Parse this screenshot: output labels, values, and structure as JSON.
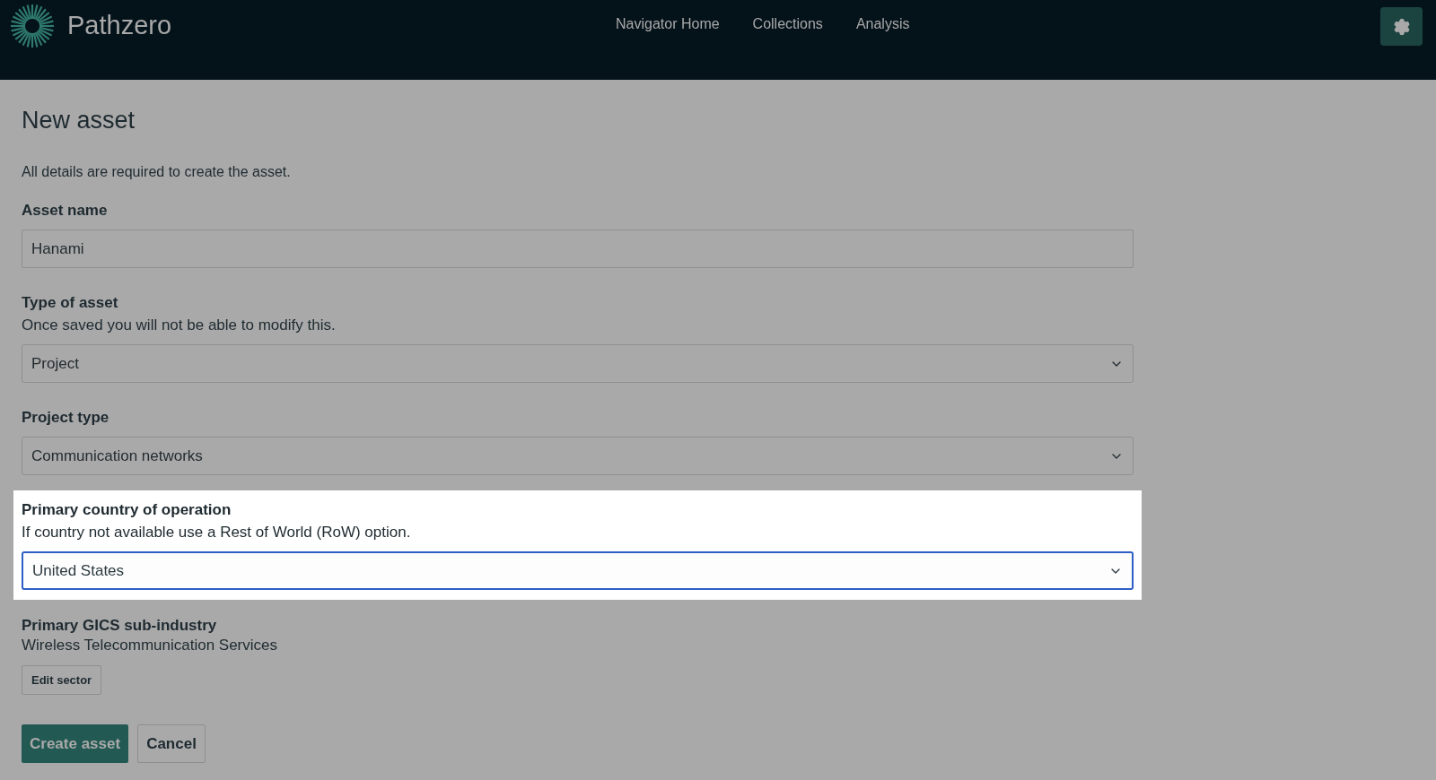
{
  "header": {
    "brand": "Pathzero",
    "nav": [
      {
        "label": "Navigator Home"
      },
      {
        "label": "Collections"
      },
      {
        "label": "Analysis"
      }
    ]
  },
  "page": {
    "title": "New asset",
    "intro": "All details are required to create the asset."
  },
  "fields": [
    {
      "kind": "text",
      "label": "Asset name",
      "value": "Hanami",
      "highlighted": false
    },
    {
      "kind": "select",
      "label": "Type of asset",
      "hint": "Once saved you will not be able to modify this.",
      "value": "Project",
      "highlighted": false
    },
    {
      "kind": "select",
      "label": "Project type",
      "value": "Communication networks",
      "highlighted": false
    },
    {
      "kind": "select",
      "label": "Primary country of operation",
      "hint": "If country not available use a Rest of World (RoW) option.",
      "value": "United States",
      "highlighted": true
    }
  ],
  "sub_industry": {
    "label": "Primary GICS sub-industry",
    "value": "Wireless Telecommunication Services",
    "button": "Edit sector"
  },
  "actions": [
    {
      "label": "Create asset",
      "kind": "primary"
    },
    {
      "label": "Cancel",
      "kind": "secondary"
    }
  ]
}
